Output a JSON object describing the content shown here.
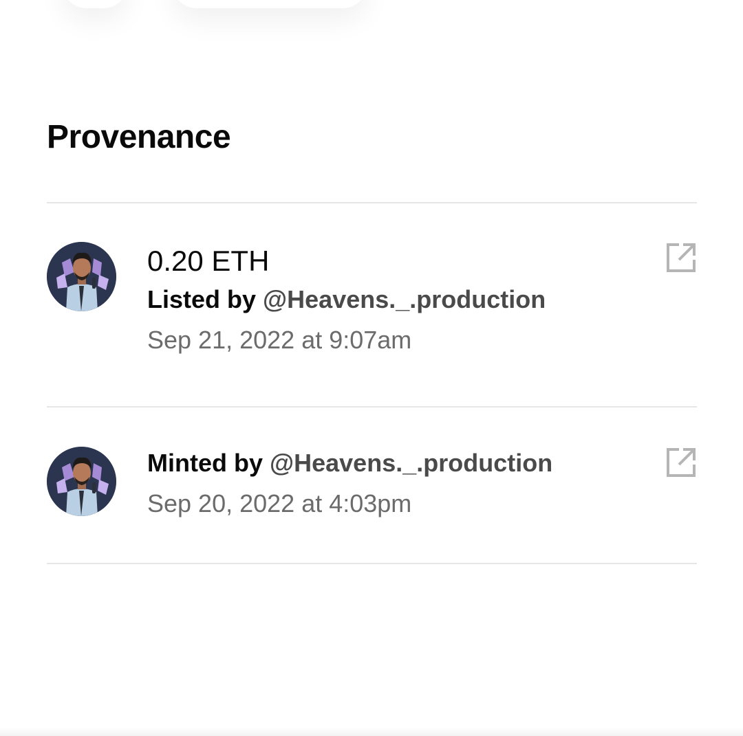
{
  "section": {
    "title": "Provenance"
  },
  "events": [
    {
      "price": "0.20 ETH",
      "verb": "Listed by",
      "handle": "@Heavens._.production",
      "timestamp": "Sep 21, 2022 at 9:07am",
      "icon": "external-link-icon"
    },
    {
      "verb": "Minted by",
      "handle": "@Heavens._.production",
      "timestamp": "Sep 20, 2022 at 4:03pm",
      "icon": "external-link-icon"
    }
  ],
  "colors": {
    "primary_text": "#0a0a0a",
    "handle_text": "#4a4a4a",
    "secondary_text": "#6b6b6b",
    "divider": "#e6e6e6",
    "icon": "#b5b5b5",
    "avatar_bg": "#2b3550"
  }
}
